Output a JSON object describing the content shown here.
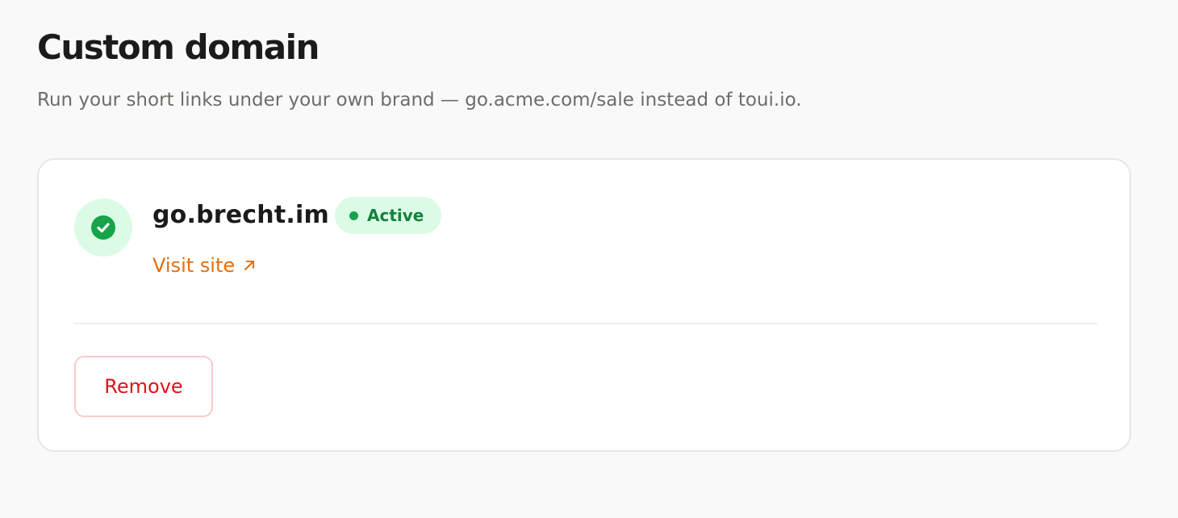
{
  "header": {
    "title": "Custom domain",
    "subtitle": "Run your short links under your own brand — go.acme.com/sale instead of toui.io."
  },
  "domain_card": {
    "status_icon": "check-circle-icon",
    "domain": "go.brecht.im",
    "status_label": "Active",
    "status_color": "#16a34a",
    "visit_link_label": "Visit site",
    "visit_link_icon": "arrow-up-right-icon",
    "remove_button_label": "Remove"
  },
  "colors": {
    "accent_link": "#e06f0f",
    "success": "#16a34a",
    "success_bg": "#dcfbe6",
    "danger": "#e0121a",
    "danger_border": "#fbcaca"
  }
}
